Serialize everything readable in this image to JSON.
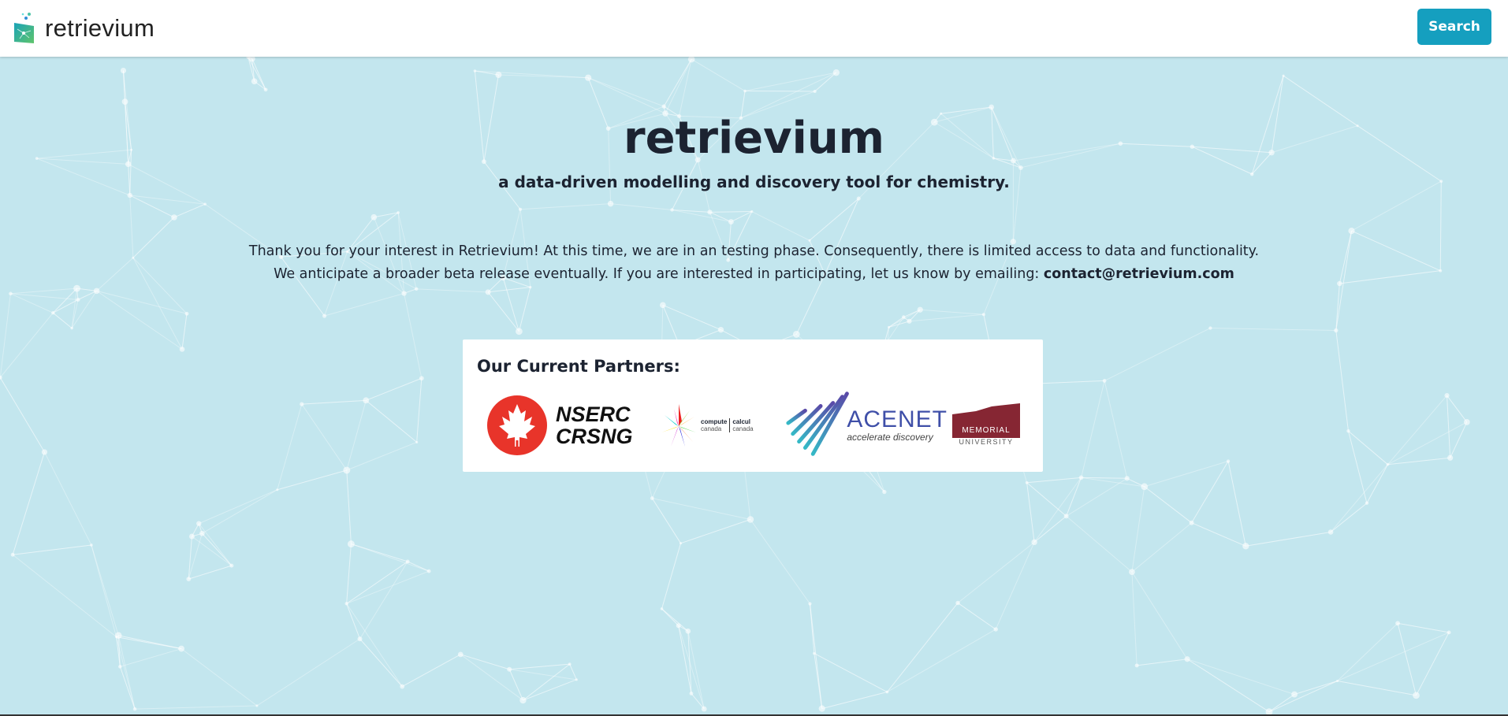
{
  "header": {
    "brand": "retrievium",
    "search_label": "Search"
  },
  "hero": {
    "title": "retrievium",
    "subtitle": "a data-driven modelling and discovery tool for chemistry."
  },
  "message": {
    "line1": "Thank you for your interest in Retrievium! At this time, we are in an testing phase. Consequently, there is limited access to data and functionality.",
    "line2": "We anticipate a broader beta release eventually. If you are interested in participating, let us know by emailing: ",
    "email": "contact@retrievium.com"
  },
  "partners": {
    "heading": "Our Current Partners:",
    "nserc": {
      "line1": "NSERC",
      "line2": "CRSNG"
    },
    "compute_canada": {
      "left_top": "compute",
      "left_bottom": "canada",
      "right_top": "calcul",
      "right_bottom": "canada"
    },
    "acenet": {
      "name": "ACENET",
      "tagline": "accelerate discovery"
    },
    "memorial": {
      "line1": "MEMORIAL",
      "line2": "UNIVERSITY"
    }
  },
  "colors": {
    "background": "#c3e6ee",
    "accent": "#159fbf",
    "nserc_red": "#e8342a",
    "acenet_blue": "#3f4fa8",
    "memorial_maroon": "#862633"
  }
}
